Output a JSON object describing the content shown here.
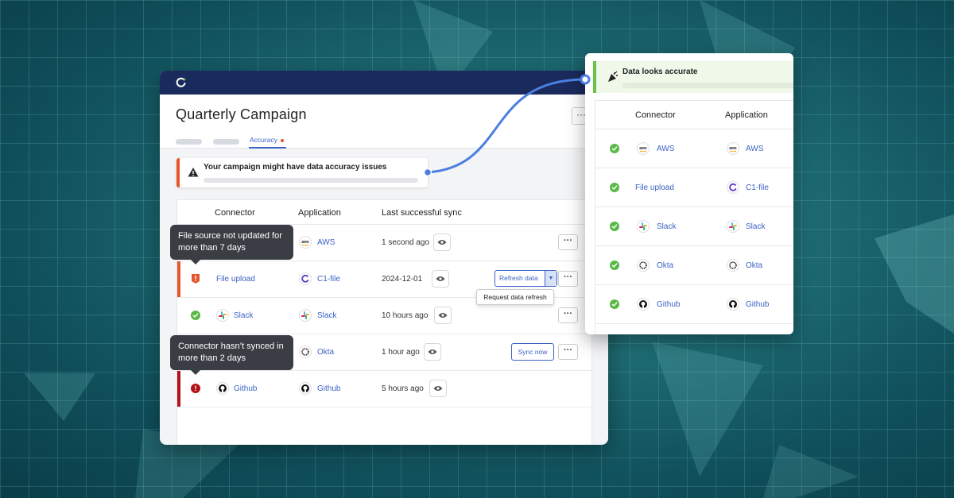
{
  "main_window": {
    "page_title": "Quarterly Campaign",
    "more_label": "···",
    "active_tab": "Accuracy",
    "alert_text": "Your campaign might have data accuracy issues",
    "table": {
      "headers": {
        "connector": "Connector",
        "application": "Application",
        "last_sync": "Last successful sync"
      },
      "rows": [
        {
          "status": "ok",
          "connector": "",
          "connector_icon": "aws-icon",
          "application": "AWS",
          "application_icon": "aws-icon",
          "last_sync": "1 second ago",
          "action": "",
          "more": "···"
        },
        {
          "status": "warning",
          "connector": "File upload",
          "connector_icon": "",
          "application": "C1-file",
          "application_icon": "c1-icon",
          "last_sync": "2024-12-01",
          "action": "Refresh data",
          "more": "···"
        },
        {
          "status": "ok",
          "connector": "Slack",
          "connector_icon": "slack-icon",
          "application": "Slack",
          "application_icon": "slack-icon",
          "last_sync": "10 hours ago",
          "action": "",
          "more": "···"
        },
        {
          "status": "ok",
          "connector": "",
          "connector_icon": "okta-icon",
          "application": "Okta",
          "application_icon": "okta-icon",
          "last_sync": "1 hour ago",
          "action": "Sync now",
          "more": "···"
        },
        {
          "status": "error",
          "connector": "Github",
          "connector_icon": "github-icon",
          "application": "Github",
          "application_icon": "github-icon",
          "last_sync": "5 hours ago",
          "action": "",
          "more": ""
        }
      ]
    },
    "dropdown_option": "Request data refresh",
    "tooltip_file": "File source not updated for more than 7 days",
    "tooltip_sync": "Connector hasn’t synced in more than 2 days"
  },
  "right_panel": {
    "banner_text": "Data looks accurate",
    "headers": {
      "connector": "Connector",
      "application": "Application"
    },
    "rows": [
      {
        "connector": "AWS",
        "connector_icon": "aws-icon",
        "application": "AWS",
        "application_icon": "aws-icon"
      },
      {
        "connector": "File upload",
        "connector_icon": "",
        "application": "C1-file",
        "application_icon": "c1-icon"
      },
      {
        "connector": "Slack",
        "connector_icon": "slack-icon",
        "application": "Slack",
        "application_icon": "slack-icon"
      },
      {
        "connector": "Okta",
        "connector_icon": "okta-icon",
        "application": "Okta",
        "application_icon": "okta-icon"
      },
      {
        "connector": "Github",
        "connector_icon": "github-icon",
        "application": "Github",
        "application_icon": "github-icon"
      }
    ]
  },
  "colors": {
    "accent_blue": "#3b63c4",
    "warning_orange": "#e4572e",
    "error_red": "#b3121a",
    "success_green": "#58b947",
    "titlebar_navy": "#1b2a5c",
    "connector_line": "#4a7fe0"
  }
}
